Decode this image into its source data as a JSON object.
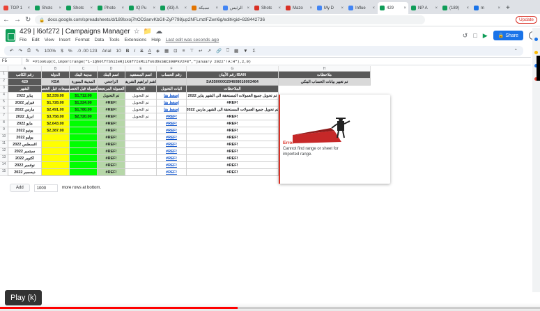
{
  "tabs": [
    {
      "label": "TOP 1",
      "color": "#ea4335"
    },
    {
      "label": "Shotc",
      "color": "#0f9d58"
    },
    {
      "label": "Shotc",
      "color": "#0f9d58"
    },
    {
      "label": "Photo",
      "color": "#0f9d58"
    },
    {
      "label": "IQ Pu",
      "color": "#0f9d58"
    },
    {
      "label": "(83) A",
      "color": "#0f9d58"
    },
    {
      "label": "سبيكة",
      "color": "#e37400"
    },
    {
      "label": "الرئيس",
      "color": "#4285f4"
    },
    {
      "label": "Shotc",
      "color": "#d93025"
    },
    {
      "label": "Mazo",
      "color": "#d93025"
    },
    {
      "label": "My D",
      "color": "#4285f4"
    },
    {
      "label": "Influe",
      "color": "#4285f4"
    },
    {
      "label": "429",
      "color": "#0f9d58",
      "active": true
    },
    {
      "label": "NP A",
      "color": "#0f9d58"
    },
    {
      "label": "(189)",
      "color": "#0f9d58"
    },
    {
      "label": "m",
      "color": "#1a73e8"
    }
  ],
  "address": {
    "url": "docs.google.com/spreadsheets/d/189lxxoj7hOD3anvKbGll-ZyP798jup2NFLmzlFZwri6g/edit#gid=828442736"
  },
  "browser": {
    "update_label": "Update"
  },
  "doc": {
    "title": "429 | l6of272 | Campaigns Manager",
    "menus": [
      "File",
      "Edit",
      "View",
      "Insert",
      "Format",
      "Data",
      "Tools",
      "Extensions",
      "Help"
    ],
    "last_edit": "Last edit was seconds ago",
    "share_label": "Share"
  },
  "toolbar": {
    "zoom": "100%",
    "font": "Arial",
    "size": "10",
    "currency": "$",
    "percent": "%",
    "format": ".0 .00 123"
  },
  "formula_bar": {
    "cell": "F5",
    "fx": "fx",
    "formula": "=Vlookup(C,importrange(\"1-1Qh0lfTSh1IeRjik8f7IsMiifskdOsSBC398PkV2F8\",\"january 2022'!A:H\"),2,0)"
  },
  "columns": [
    "A",
    "B",
    "C",
    "D",
    "E",
    "F",
    "G",
    "H"
  ],
  "header_row": {
    "labels": [
      "رقم الكاتب",
      "الدولة",
      "مدينة البنك",
      "اسم البنك",
      "اسم المستفيد",
      "رقم الحساب",
      "رقم الآيبان IBAN",
      "ملاحظات"
    ]
  },
  "info_row": {
    "values": [
      "429",
      "KSA",
      "المدينة المنورة",
      "الراجحي",
      "هاشم ابراهيم الشريف",
      "",
      "SA5500000294608016003464",
      "تم تغيير بيانات الحساب البنكي"
    ]
  },
  "table_header": {
    "labels": [
      "الشهر",
      "المبيعات قبل الخصم",
      "العمولة قبل الخصم",
      "العمولة المرتجعة",
      "الحالة",
      "اثبات التحويل",
      "الملاحظات"
    ]
  },
  "rows": [
    {
      "month": "يناير 2022",
      "sales": "$2,339.00",
      "commission": "$1,712.00",
      "returned": "تم التحويل",
      "status": "تم التحويل",
      "proof": "إضغط هنا",
      "note": "تم تحويل جميع العمولات المستحقة الى الشهر يناير 2022"
    },
    {
      "month": "فبراير 2022",
      "sales": "$1,728.00",
      "commission": "$1,324.00",
      "returned": "#REF!",
      "status": "تم التحويل",
      "proof": "إضغط هنا",
      "note": "#REF!"
    },
    {
      "month": "مارس 2022",
      "sales": "$2,491.00",
      "commission": "$1,780.00",
      "returned": "#REF!",
      "status": "تم التحويل",
      "proof": "إضغط هنا",
      "note": "تم تحويل جميع العمولات المستحقة الى الشهر مارس 2022"
    },
    {
      "month": "ابريل 2022",
      "sales": "$3,758.00",
      "commission": "$2,720.00",
      "returned": "#REF!",
      "status": "تم التحويل",
      "proof": "#REF!",
      "note": "#REF!"
    },
    {
      "month": "مايو 2022",
      "sales": "$2,643.00",
      "commission": "",
      "returned": "#REF!",
      "status": "",
      "proof": "#REF!",
      "note": "#REF!"
    },
    {
      "month": "يونيو 2022",
      "sales": "$2,387.00",
      "commission": "",
      "returned": "#REF!",
      "status": "",
      "proof": "#REF!",
      "note": "#REF!"
    },
    {
      "month": "يوليو 2022",
      "sales": "",
      "commission": "",
      "returned": "#REF!",
      "status": "",
      "proof": "#REF!",
      "note": "#REF!"
    },
    {
      "month": "اغسطس 2022",
      "sales": "",
      "commission": "",
      "returned": "#REF!",
      "status": "",
      "proof": "#REF!",
      "note": "#REF!"
    },
    {
      "month": "سبتمبر 2022",
      "sales": "",
      "commission": "",
      "returned": "#REF!",
      "status": "",
      "proof": "#REF!",
      "note": "#REF!"
    },
    {
      "month": "اكتوبر 2022",
      "sales": "",
      "commission": "",
      "returned": "#REF!",
      "status": "",
      "proof": "#REF!",
      "note": "#REF!"
    },
    {
      "month": "نوفمبر 2022",
      "sales": "",
      "commission": "",
      "returned": "#REF!",
      "status": "",
      "proof": "#REF!",
      "note": "#REF!"
    },
    {
      "month": "ديسمبر 2022",
      "sales": "",
      "commission": "",
      "returned": "#REF!",
      "status": "",
      "proof": "#REF!",
      "note": "#REF!"
    }
  ],
  "error": {
    "title": "Error",
    "message": "Cannot find range or sheet for imported range."
  },
  "add_rows": {
    "button": "Add",
    "count": "1000",
    "suffix": "more rows at bottom."
  },
  "player": {
    "play_label": "Play (k)",
    "progress": 0.44
  }
}
